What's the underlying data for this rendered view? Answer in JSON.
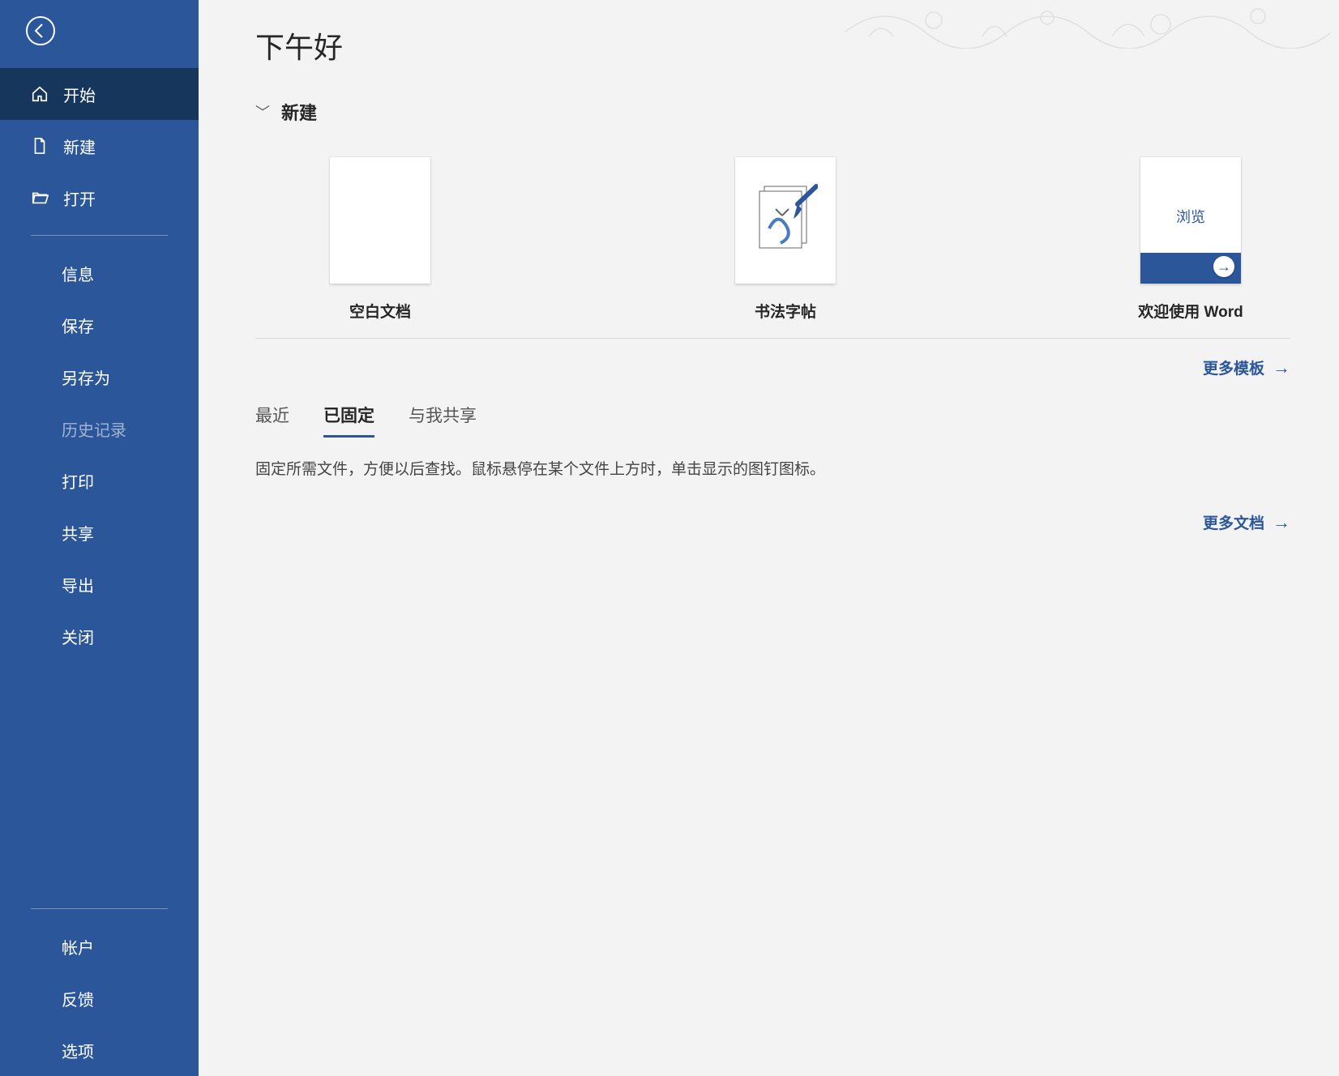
{
  "sidebar": {
    "items": [
      {
        "label": "开始",
        "icon": "home",
        "active": true
      },
      {
        "label": "新建",
        "icon": "document"
      },
      {
        "label": "打开",
        "icon": "folder-open"
      }
    ],
    "items2": [
      {
        "label": "信息"
      },
      {
        "label": "保存"
      },
      {
        "label": "另存为"
      },
      {
        "label": "历史记录",
        "disabled": true
      },
      {
        "label": "打印"
      },
      {
        "label": "共享"
      },
      {
        "label": "导出"
      },
      {
        "label": "关闭"
      }
    ],
    "items3": [
      {
        "label": "帐户"
      },
      {
        "label": "反馈"
      },
      {
        "label": "选项"
      }
    ]
  },
  "main": {
    "greeting": "下午好",
    "new_section_title": "新建",
    "templates": [
      {
        "label": "空白文档",
        "browse": ""
      },
      {
        "label": "书法字帖",
        "browse": ""
      },
      {
        "label": "欢迎使用 Word",
        "browse": "浏览"
      }
    ],
    "more_templates": "更多模板",
    "tabs": [
      {
        "label": "最近",
        "active": false
      },
      {
        "label": "已固定",
        "active": true
      },
      {
        "label": "与我共享",
        "active": false
      }
    ],
    "pinned_hint": "固定所需文件，方便以后查找。鼠标悬停在某个文件上方时，单击显示的图钉图标。",
    "more_docs": "更多文档"
  }
}
